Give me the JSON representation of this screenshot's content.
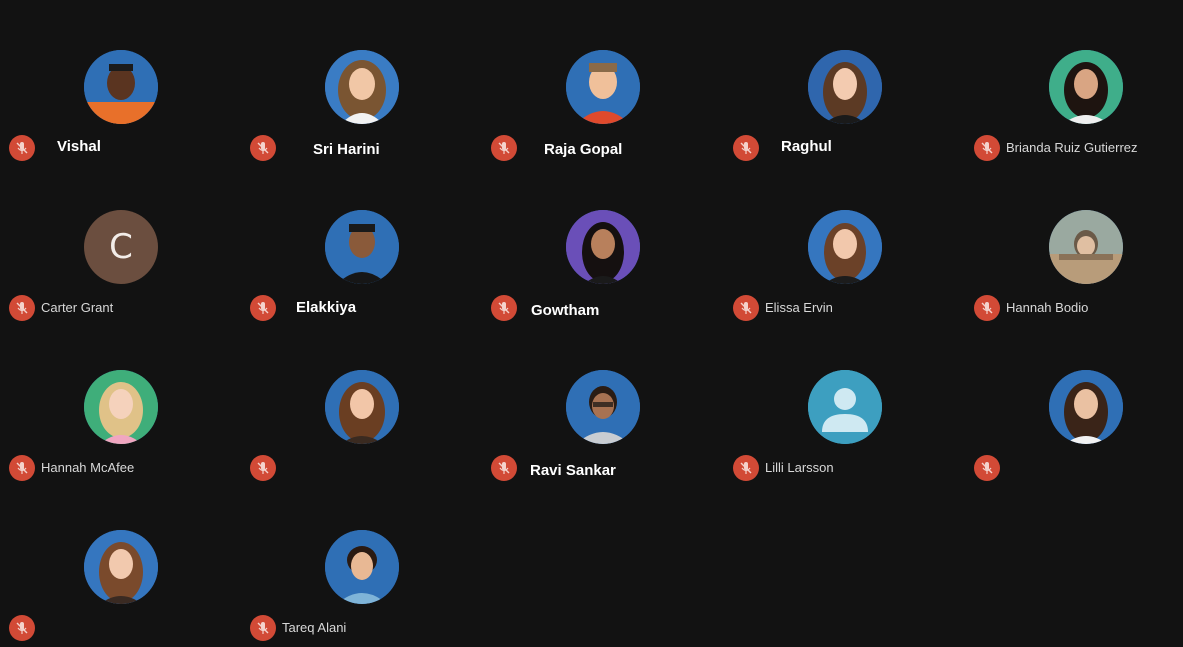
{
  "participants": [
    {
      "name": "Vishal",
      "bold": true
    },
    {
      "name": "Sri Harini",
      "bold": true
    },
    {
      "name": "Raja Gopal",
      "bold": true
    },
    {
      "name": "Raghul",
      "bold": true
    },
    {
      "name": "Brianda Ruiz Gutierrez",
      "bold": false
    },
    {
      "name": "Carter Grant",
      "bold": false,
      "initial": "C"
    },
    {
      "name": "Elakkiya",
      "bold": true
    },
    {
      "name": "Gowtham",
      "bold": true
    },
    {
      "name": "Elissa Ervin",
      "bold": false
    },
    {
      "name": "Hannah Bodio",
      "bold": false
    },
    {
      "name": "Hannah McAfee",
      "bold": false
    },
    {
      "name": "",
      "bold": false
    },
    {
      "name": "Ravi Sankar",
      "bold": true
    },
    {
      "name": "Lilli Larsson",
      "bold": false
    },
    {
      "name": "",
      "bold": false
    },
    {
      "name": "",
      "bold": false
    },
    {
      "name": "Tareq Alani",
      "bold": false
    }
  ],
  "colors": {
    "background": "#121212",
    "mic_muted": "#d24a36",
    "letter_avatar": "#6b4e3f",
    "default_avatar": "#3d9fc0"
  },
  "icons": {
    "mic": "mic-off-icon"
  }
}
